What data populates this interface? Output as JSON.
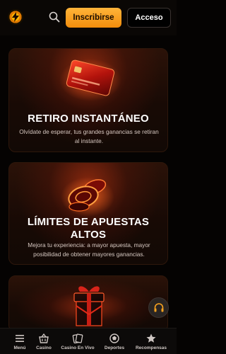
{
  "header": {
    "signup_label": "Inscribirse",
    "login_label": "Acceso"
  },
  "cards": [
    {
      "title": "RETIRO INSTANTÁNEO",
      "description": "Olvídate de esperar, tus grandes ganancias se retiran al instante."
    },
    {
      "title_line1": "LÍMITES DE APUESTAS",
      "title_line2": "ALTOS",
      "description": "Mejora tu experiencia: a mayor apuesta, mayor posibilidad de obtener mayores ganancias."
    },
    {
      "image": "gift-icon"
    }
  ],
  "bottom_nav": [
    {
      "label": "Menú",
      "icon": "menu-icon"
    },
    {
      "label": "Casino",
      "icon": "basket-icon"
    },
    {
      "label": "Casino En Vivo",
      "icon": "cards-icon"
    },
    {
      "label": "Deportes",
      "icon": "sports-icon"
    },
    {
      "label": "Recompensas",
      "icon": "star-icon"
    }
  ],
  "colors": {
    "accent": "#f7a21e",
    "background": "#050302",
    "card": "#1c0b05"
  }
}
